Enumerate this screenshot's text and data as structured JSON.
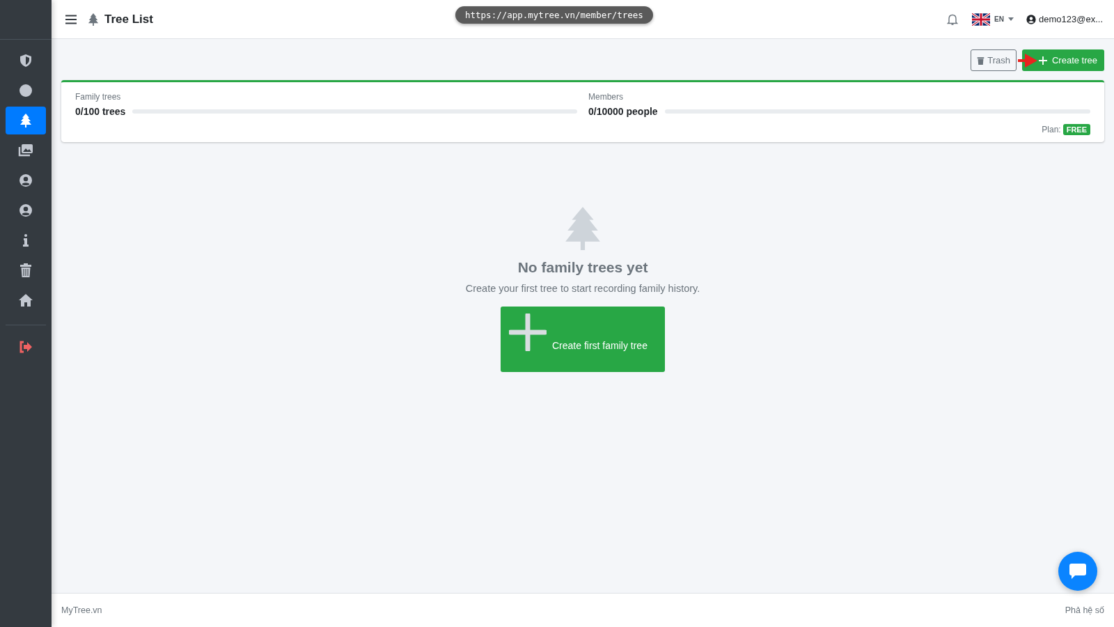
{
  "header": {
    "title": "Tree List",
    "url": "https://app.mytree.vn/member/trees",
    "language": "EN",
    "user": "demo123@ex..."
  },
  "sidebar": {
    "items": [
      {
        "kind": "shield",
        "selected": false
      },
      {
        "kind": "circle",
        "selected": false
      },
      {
        "kind": "tree",
        "selected": true
      },
      {
        "kind": "images",
        "selected": false
      },
      {
        "kind": "user",
        "selected": false
      },
      {
        "kind": "user",
        "selected": false
      },
      {
        "kind": "info",
        "selected": false
      },
      {
        "kind": "trash",
        "selected": false
      },
      {
        "kind": "home",
        "selected": false
      },
      {
        "kind": "logout",
        "selected": false
      }
    ]
  },
  "toolbar": {
    "trash_button": "Trash",
    "create_button": "Create tree"
  },
  "usage": {
    "stats": [
      {
        "label": "Family trees",
        "value": "0/100 trees",
        "level": 0
      },
      {
        "label": "Members",
        "value": "0/10000 people",
        "level": 0
      }
    ],
    "plan_label": "Plan:",
    "plan": "FREE"
  },
  "empty_state": {
    "title": "No family trees yet",
    "message": "Create your first tree to start recording family history.",
    "button": "Create first family tree"
  },
  "footer": {
    "left": "MyTree.vn",
    "right": "Phả hệ số"
  }
}
